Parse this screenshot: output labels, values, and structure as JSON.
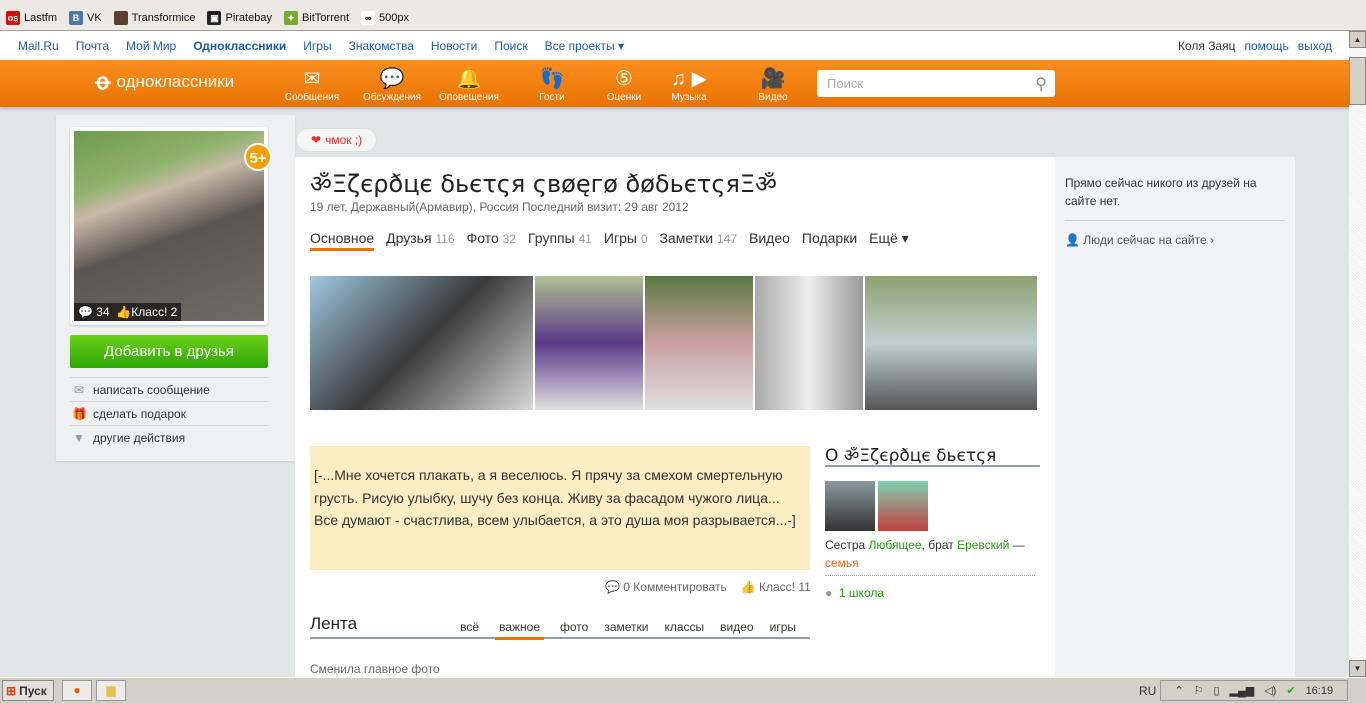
{
  "bookmarks": [
    {
      "label": "Lastfm",
      "icon": "lastfm-icon",
      "color": "#d51007",
      "glyph": "os"
    },
    {
      "label": "VK",
      "icon": "vk-icon",
      "color": "#4a76a8",
      "glyph": "B"
    },
    {
      "label": "Transformice",
      "icon": "transformice-icon",
      "color": "#5a4030",
      "glyph": ""
    },
    {
      "label": "Piratebay",
      "icon": "piratebay-icon",
      "color": "#222",
      "glyph": "▣"
    },
    {
      "label": "BitTorrent",
      "icon": "bittorrent-icon",
      "color": "#7a3",
      "glyph": "✦"
    },
    {
      "label": "500px",
      "icon": "500px-icon",
      "color": "#fff",
      "glyph": "∞"
    }
  ],
  "topnav": {
    "items": [
      "Mail.Ru",
      "Почта",
      "Мой Мир",
      "Одноклассники",
      "Игры",
      "Знакомства",
      "Новости",
      "Поиск",
      "Все проекты ▾"
    ],
    "user": "Коля Заяц",
    "help": "помощь",
    "logout": "выход"
  },
  "header": {
    "logo": "одноклассники",
    "tools": [
      {
        "label": "Сообщения",
        "glyph": "✉"
      },
      {
        "label": "Обсуждения",
        "glyph": "💬"
      },
      {
        "label": "Оповещения",
        "glyph": "🔔"
      },
      {
        "label": "Гости",
        "glyph": "👣"
      },
      {
        "label": "Оценки",
        "glyph": "⑤"
      },
      {
        "label": "Музыка",
        "glyph": "♫ ▶"
      },
      {
        "label": "Видео",
        "glyph": "🎥"
      }
    ],
    "search_placeholder": "Поиск"
  },
  "profile": {
    "badge": "5+",
    "comments": "34",
    "klass": "Класс! 2",
    "add_friend": "Добавить в друзья",
    "actions": [
      "написать сообщение",
      "сделать подарок",
      "другие действия"
    ],
    "gift_label": "чмок ;)",
    "name": "ॐΞζєρðцє δьєτςя ςвøęгø ðøδьєτςяΞॐ",
    "meta": "19 лет, Державный(Армавир), Россия  Последний визит: 29 авг 2012",
    "tabs": [
      {
        "label": "Основное",
        "count": ""
      },
      {
        "label": "Друзья",
        "count": "116"
      },
      {
        "label": "Фото",
        "count": "32"
      },
      {
        "label": "Группы",
        "count": "41"
      },
      {
        "label": "Игры",
        "count": "0"
      },
      {
        "label": "Заметки",
        "count": "147"
      },
      {
        "label": "Видео",
        "count": ""
      },
      {
        "label": "Подарки",
        "count": ""
      },
      {
        "label": "Ещё ▾",
        "count": ""
      }
    ]
  },
  "status": {
    "text": "[-...Мне хочется плакать, а я веселюсь. Я прячу за смехом смертельную грусть. Рисую улыбку, шучу без конца. Живу за фасадом чужого лица... Все думают - счастлива, всем улыбается, а это душа моя разрывается...-]",
    "comments": "0 Комментировать",
    "klass": "Класс! 11"
  },
  "feed": {
    "title": "Лента",
    "tabs": [
      "всё",
      "важное",
      "фото",
      "заметки",
      "классы",
      "видео",
      "игры"
    ],
    "active": "важное",
    "event": "Сменила главное фото"
  },
  "about": {
    "title": "О ॐΞζєρðцє δьєτςя",
    "rel_prefix": "Сестра ",
    "sister": "Любящее",
    "rel_mid": ", брат ",
    "brother": "Еревский",
    "rel_suffix": " — ",
    "family": "семья",
    "school": "1 школа"
  },
  "right": {
    "no_friends": "Прямо сейчас никого из друзей на сайте нет.",
    "people": "Люди сейчас на сайте ›"
  },
  "taskbar": {
    "start": "Пуск",
    "lang": "RU",
    "time": "16:19"
  }
}
